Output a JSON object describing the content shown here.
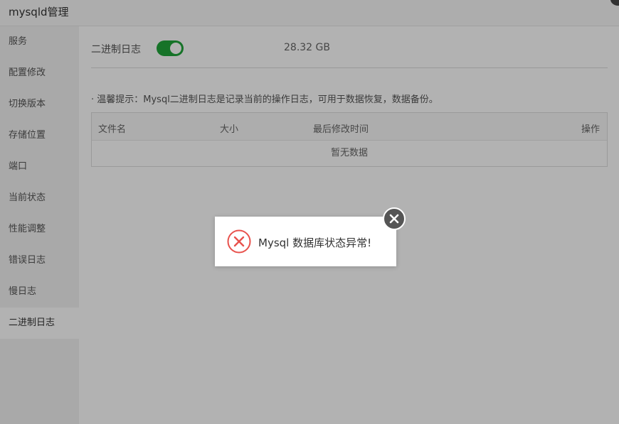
{
  "window": {
    "title": "mysqld管理"
  },
  "sidebar": {
    "items": [
      {
        "label": "服务"
      },
      {
        "label": "配置修改"
      },
      {
        "label": "切换版本"
      },
      {
        "label": "存储位置"
      },
      {
        "label": "端口"
      },
      {
        "label": "当前状态"
      },
      {
        "label": "性能调整"
      },
      {
        "label": "错误日志"
      },
      {
        "label": "慢日志"
      },
      {
        "label": "二进制日志",
        "active": true
      }
    ]
  },
  "binlog": {
    "label": "二进制日志",
    "enabled": true,
    "size": "28.32 GB",
    "tip": "· 温馨提示：Mysql二进制日志是记录当前的操作日志，可用于数据恢复，数据备份。"
  },
  "table": {
    "columns": [
      "文件名",
      "大小",
      "最后修改时间",
      "操作"
    ],
    "empty_text": "暂无数据"
  },
  "dialog": {
    "message": "Mysql 数据库状态异常!",
    "icon": "error-circle-icon",
    "close_icon": "close-icon"
  },
  "colors": {
    "accent_green": "#20a53a",
    "error_red": "#e8514c",
    "overlay": "rgba(0,0,0,0.3)"
  }
}
